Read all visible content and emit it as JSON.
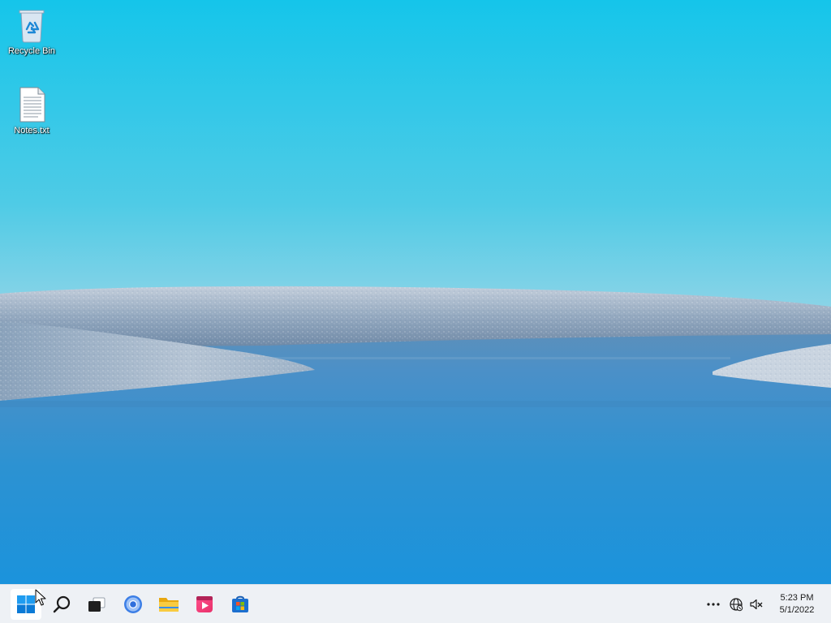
{
  "desktop": {
    "icons": [
      {
        "label": "Recycle Bin",
        "icon": "recycle-bin-icon"
      },
      {
        "label": "Notes.txt",
        "icon": "text-file-icon"
      }
    ]
  },
  "taskbar": {
    "apps": [
      {
        "name": "Start",
        "icon": "windows-logo-icon"
      },
      {
        "name": "Search",
        "icon": "search-icon"
      },
      {
        "name": "Task View",
        "icon": "task-view-icon"
      },
      {
        "name": "Chrome",
        "icon": "chrome-icon"
      },
      {
        "name": "File Explorer",
        "icon": "folder-icon"
      },
      {
        "name": "Media Player",
        "icon": "media-player-icon"
      },
      {
        "name": "Microsoft Store",
        "icon": "store-icon"
      }
    ],
    "tray": {
      "overflow_icon": "ellipsis-icon",
      "network_icon": "globe-network-icon",
      "volume_icon": "volume-muted-icon"
    },
    "clock": {
      "time": "5:23 PM",
      "date": "5/1/2022"
    }
  },
  "colors": {
    "sky_top": "#16c5ea",
    "sky_horizon": "#dfe3ec",
    "water": "#1a8fd4",
    "taskbar": "#eef1f5",
    "accent": "#0078d4"
  }
}
